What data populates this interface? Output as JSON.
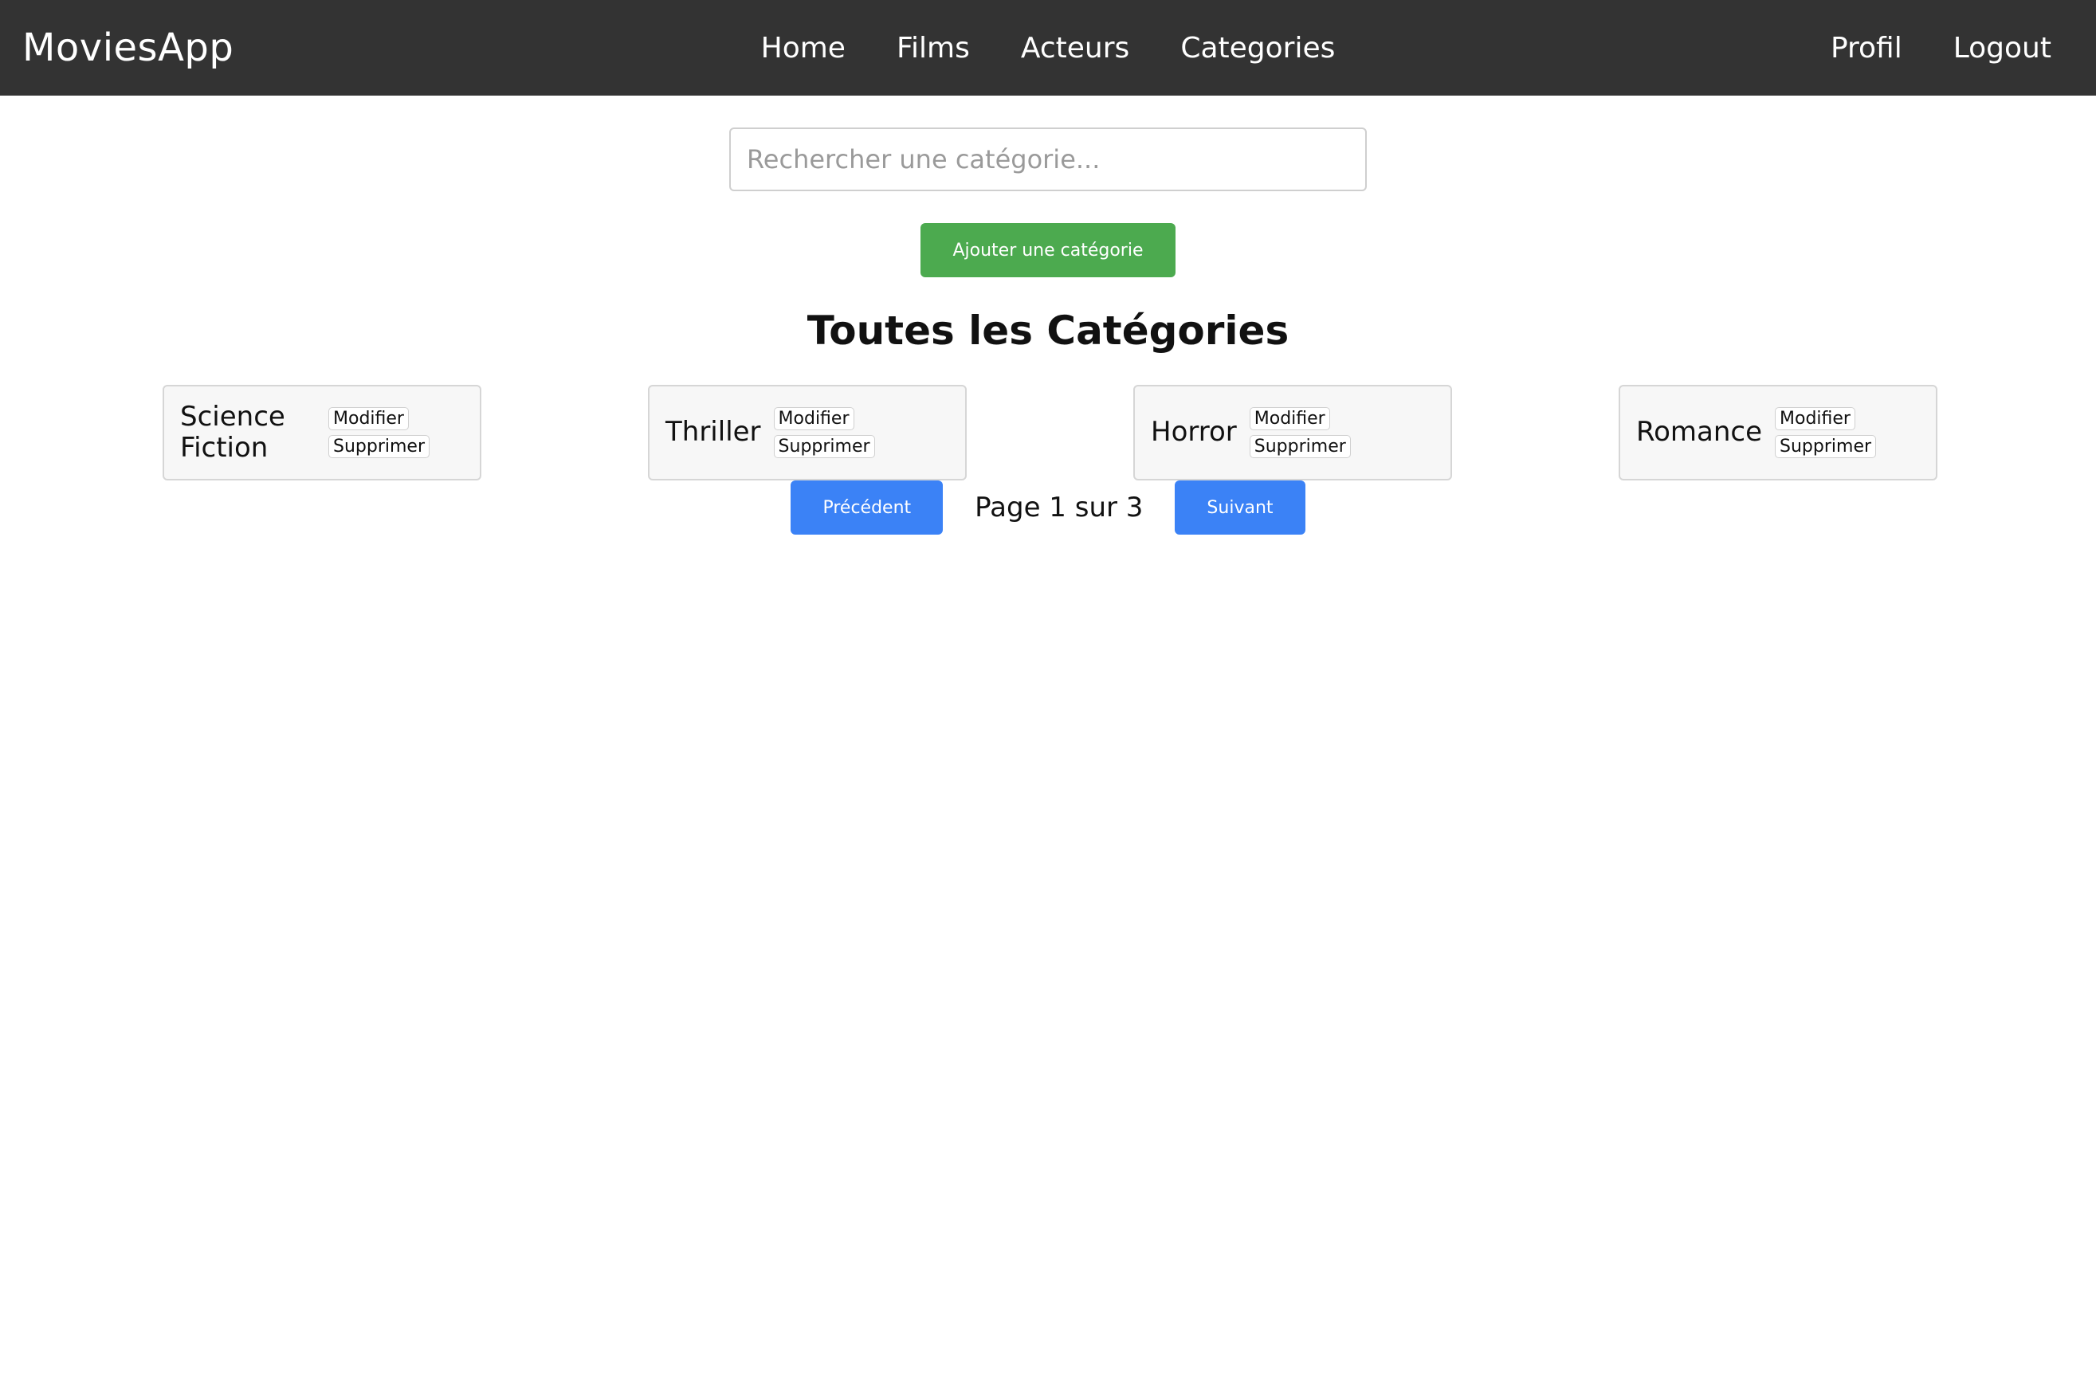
{
  "navbar": {
    "brand": "MoviesApp",
    "links": [
      "Home",
      "Films",
      "Acteurs",
      "Categories"
    ],
    "right_links": [
      "Profil",
      "Logout"
    ]
  },
  "search": {
    "placeholder": "Rechercher une catégorie..."
  },
  "add_button_label": "Ajouter une catégorie",
  "page_title": "Toutes les Catégories",
  "categories": [
    {
      "name": "Science Fiction",
      "edit_label": "Modifier",
      "delete_label": "Supprimer"
    },
    {
      "name": "Thriller",
      "edit_label": "Modifier",
      "delete_label": "Supprimer"
    },
    {
      "name": "Horror",
      "edit_label": "Modifier",
      "delete_label": "Supprimer"
    },
    {
      "name": "Romance",
      "edit_label": "Modifier",
      "delete_label": "Supprimer"
    }
  ],
  "pagination": {
    "prev_label": "Précédent",
    "page_info": "Page 1 sur 3",
    "next_label": "Suivant"
  },
  "colors": {
    "navbar_bg": "#333333",
    "add_button": "#4caa4f",
    "pagination_button": "#3b82f6"
  }
}
